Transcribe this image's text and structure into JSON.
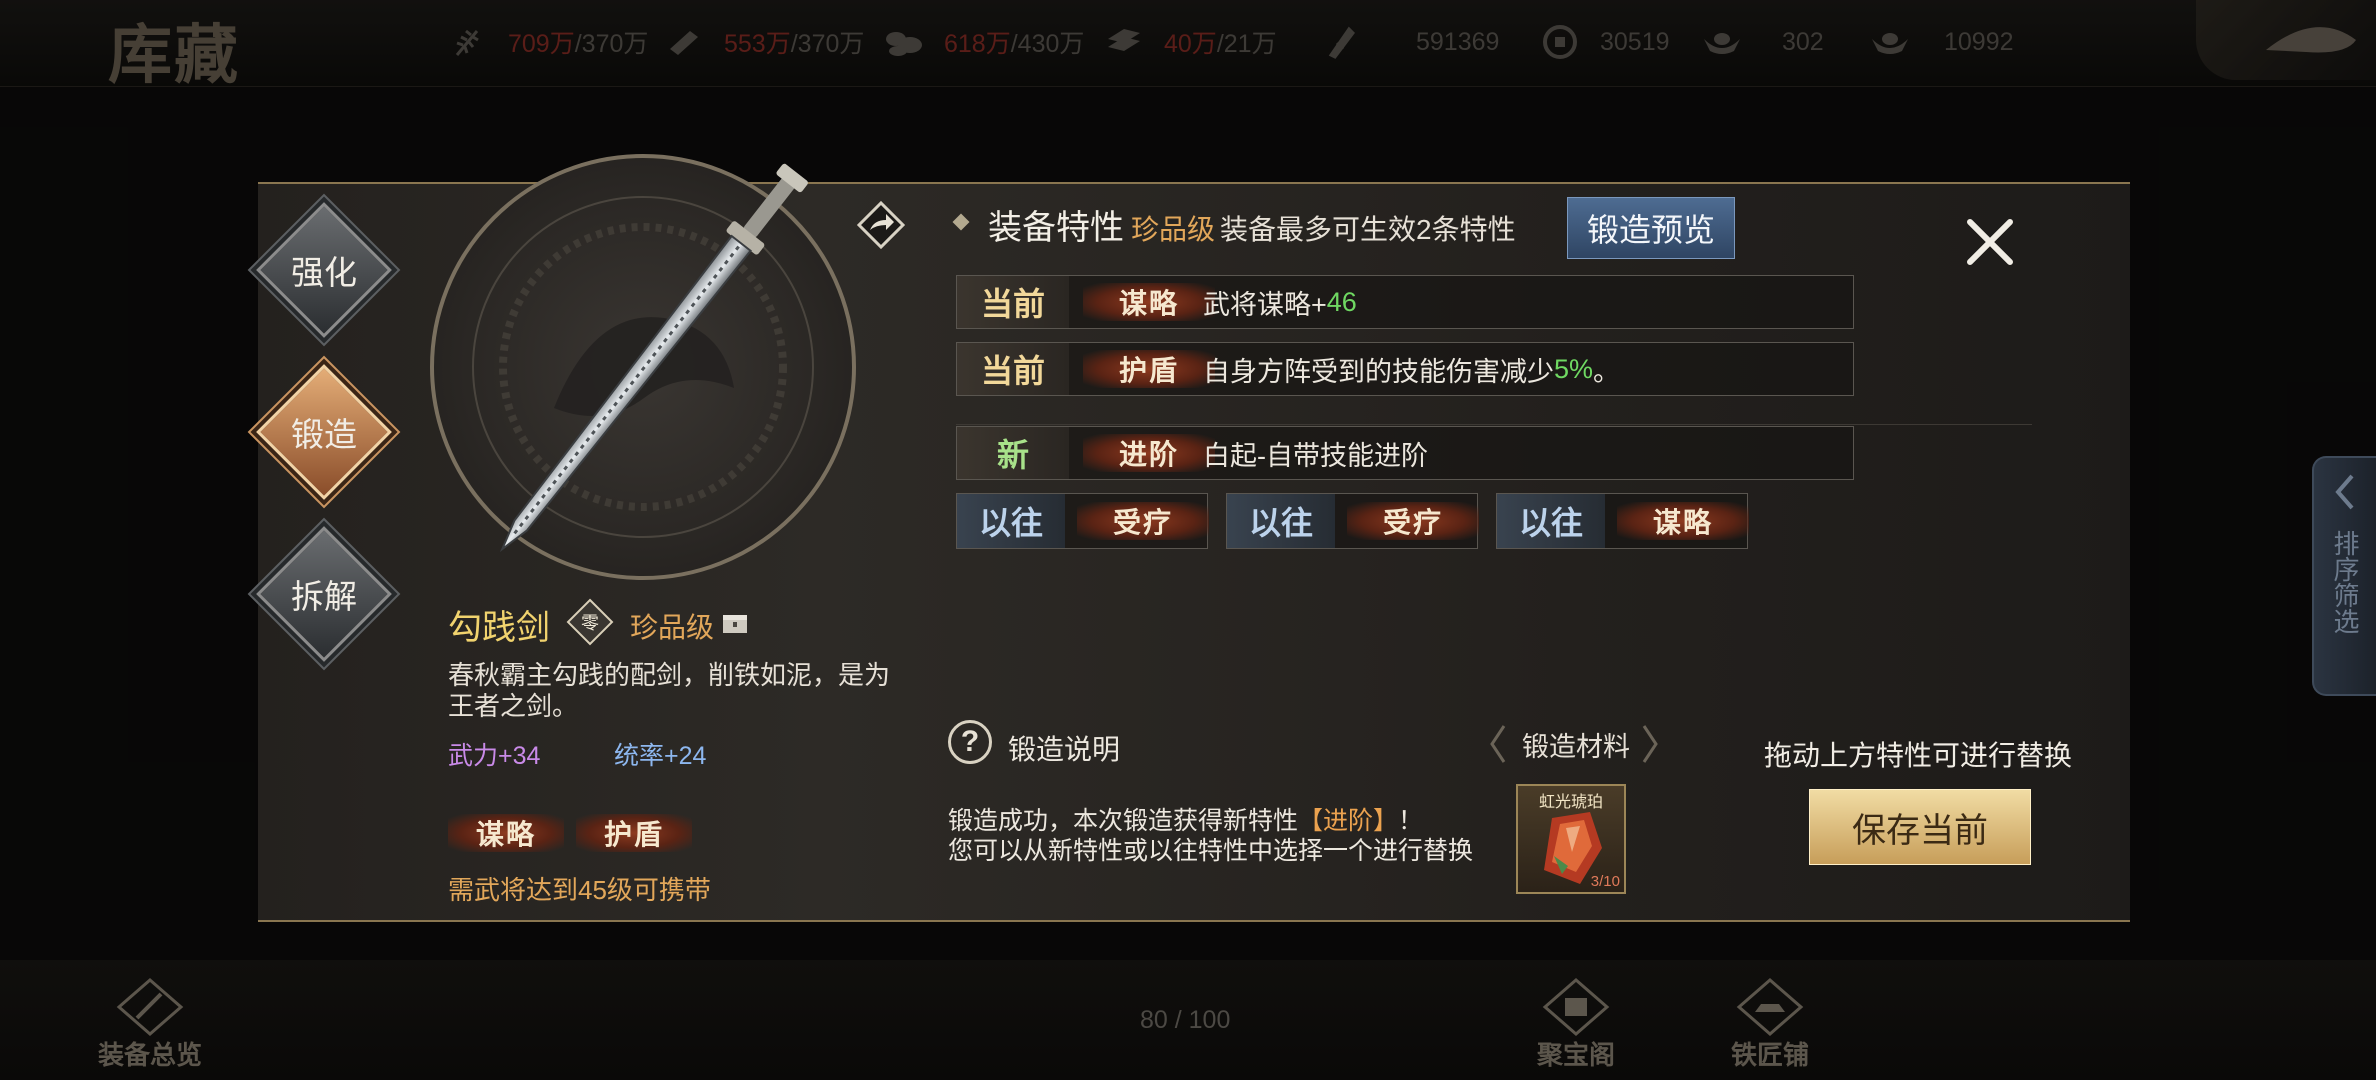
{
  "screen_title": "库藏",
  "resources": [
    {
      "icon": "grain-icon",
      "current": "709万",
      "max": "/370万"
    },
    {
      "icon": "wood-icon",
      "current": "553万",
      "max": "/370万"
    },
    {
      "icon": "stone-icon",
      "current": "618万",
      "max": "/430万"
    },
    {
      "icon": "iron-icon",
      "current": "40万",
      "max": "/21万"
    },
    {
      "icon": "decree-icon",
      "value": "591369"
    },
    {
      "icon": "copper-coin-icon",
      "value": "30519"
    },
    {
      "icon": "gold-ingot-icon",
      "value": "302"
    },
    {
      "icon": "jade-icon",
      "value": "10992"
    }
  ],
  "side_menu": [
    "强化",
    "锻造",
    "拆解"
  ],
  "item": {
    "name": "勾践剑",
    "grade_badge": "零",
    "grade": "珍品级",
    "description": "春秋霸主勾践的配剑，削铁如泥，是为王者之剑。",
    "stats": [
      "武力+34",
      "统率+24"
    ],
    "traits": [
      "谋略",
      "护盾"
    ],
    "requirement": "需武将达到45级可携带"
  },
  "header": {
    "title": "装备特性",
    "grade": "珍品级",
    "subtitle": "装备最多可生效2条特性",
    "preview_button": "锻造预览"
  },
  "trait_rows": [
    {
      "kind": "当前",
      "tag": "谋略",
      "text": "武将谋略+",
      "value": "46",
      "suffix": ""
    },
    {
      "kind": "当前",
      "tag": "护盾",
      "text": "自身方阵受到的技能伤害减少",
      "value": "5%",
      "suffix": "。"
    },
    {
      "kind": "新",
      "tag": "进阶",
      "text": "白起-自带技能进阶",
      "value": "",
      "suffix": ""
    }
  ],
  "past_traits": [
    {
      "kind": "以往",
      "tag": "受疗"
    },
    {
      "kind": "以往",
      "tag": "受疗"
    },
    {
      "kind": "以往",
      "tag": "谋略"
    }
  ],
  "forge_help": "锻造说明",
  "material": {
    "title": "锻造材料",
    "name": "虹光琥珀",
    "count": "3/10"
  },
  "drag_hint": "拖动上方特性可进行替换",
  "result": {
    "line1_pre": "锻造成功，本次锻造获得新特性",
    "line1_tag": "【进阶】",
    "line1_post": "！",
    "line2": "您可以从新特性或以往特性中选择一个进行替换"
  },
  "save_button": "保存当前",
  "side_tab_label": "排序筛选",
  "bottom_nav": [
    "装备总览",
    "聚宝阁",
    "铁匠铺"
  ],
  "capacity": "80 / 100",
  "colors": {
    "gold": "#f1d36e",
    "orange": "#e2a75a",
    "green": "#6fd862",
    "panel_border": "#8a7650"
  }
}
